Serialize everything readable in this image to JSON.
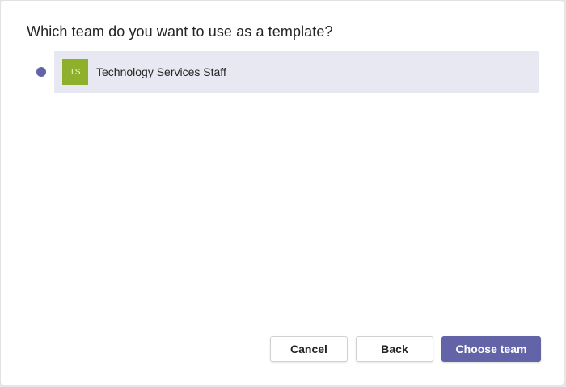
{
  "dialog": {
    "title": "Which team do you want to use as a template?"
  },
  "teams": [
    {
      "initials": "TS",
      "name": "Technology Services Staff",
      "avatar_color": "#8fb02a",
      "selected": true
    }
  ],
  "buttons": {
    "cancel_label": "Cancel",
    "back_label": "Back",
    "choose_label": "Choose team"
  },
  "colors": {
    "accent": "#6264a7",
    "selected_row_bg": "#e8e8f2"
  }
}
